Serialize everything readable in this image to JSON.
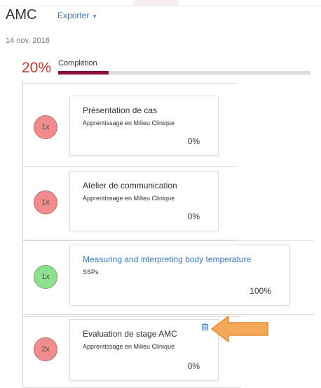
{
  "header": {
    "title": "AMC",
    "export_label": "Exporter",
    "export_caret": "▾",
    "date": "14 nov. 2018"
  },
  "completion": {
    "percent_label": "20%",
    "label": "Complétion",
    "fraction": 0.2
  },
  "activities": [
    {
      "badge": "1x",
      "badge_status": "incomplete",
      "title": "Présentation de cas",
      "subtitle": "Apprentissage en Milieu Clinique",
      "progress": "0%"
    },
    {
      "badge": "1x",
      "badge_status": "incomplete",
      "title": "Atelier de communication",
      "subtitle": "Apprentissage en Milieu Clinique",
      "progress": "0%"
    },
    {
      "badge": "1x",
      "badge_status": "complete",
      "title": "Measuring and interpreting body temperature",
      "subtitle": "SSPs",
      "progress": "100%"
    },
    {
      "badge": "2x",
      "badge_status": "incomplete",
      "title": "Evaluation de stage AMC",
      "subtitle": "Apprentissage en Milieu Clinique",
      "progress": "0%",
      "icon": "clipboard-icon"
    }
  ],
  "annotation": {
    "icon": "arrow-left-icon"
  },
  "colors": {
    "accent_link": "#3a78c2",
    "percent_red": "#c0392b",
    "progress_fill": "#8b0f3c",
    "badge_incomplete": "#f28b8b",
    "badge_complete": "#8ee08e",
    "arrow": "#f4a85a"
  }
}
